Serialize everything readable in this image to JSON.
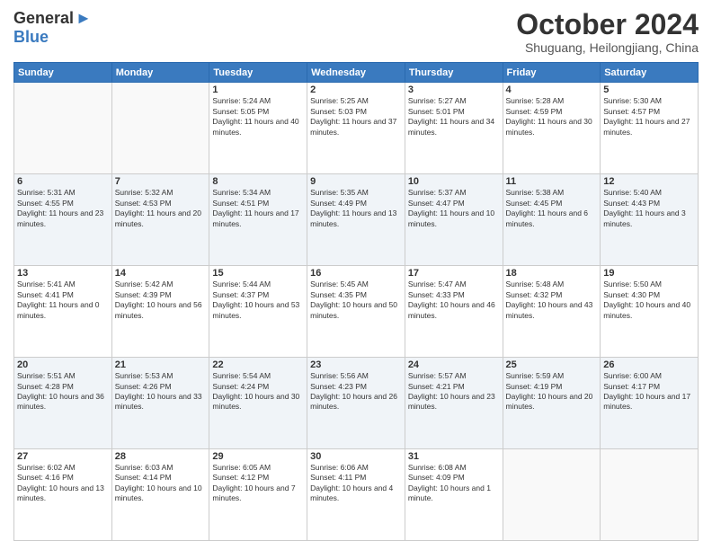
{
  "logo": {
    "general": "General",
    "blue": "Blue",
    "arrow": "▶"
  },
  "title": "October 2024",
  "location": "Shuguang, Heilongjiang, China",
  "days_of_week": [
    "Sunday",
    "Monday",
    "Tuesday",
    "Wednesday",
    "Thursday",
    "Friday",
    "Saturday"
  ],
  "weeks": [
    [
      {
        "day": "",
        "info": ""
      },
      {
        "day": "",
        "info": ""
      },
      {
        "day": "1",
        "info": "Sunrise: 5:24 AM\nSunset: 5:05 PM\nDaylight: 11 hours and 40 minutes."
      },
      {
        "day": "2",
        "info": "Sunrise: 5:25 AM\nSunset: 5:03 PM\nDaylight: 11 hours and 37 minutes."
      },
      {
        "day": "3",
        "info": "Sunrise: 5:27 AM\nSunset: 5:01 PM\nDaylight: 11 hours and 34 minutes."
      },
      {
        "day": "4",
        "info": "Sunrise: 5:28 AM\nSunset: 4:59 PM\nDaylight: 11 hours and 30 minutes."
      },
      {
        "day": "5",
        "info": "Sunrise: 5:30 AM\nSunset: 4:57 PM\nDaylight: 11 hours and 27 minutes."
      }
    ],
    [
      {
        "day": "6",
        "info": "Sunrise: 5:31 AM\nSunset: 4:55 PM\nDaylight: 11 hours and 23 minutes."
      },
      {
        "day": "7",
        "info": "Sunrise: 5:32 AM\nSunset: 4:53 PM\nDaylight: 11 hours and 20 minutes."
      },
      {
        "day": "8",
        "info": "Sunrise: 5:34 AM\nSunset: 4:51 PM\nDaylight: 11 hours and 17 minutes."
      },
      {
        "day": "9",
        "info": "Sunrise: 5:35 AM\nSunset: 4:49 PM\nDaylight: 11 hours and 13 minutes."
      },
      {
        "day": "10",
        "info": "Sunrise: 5:37 AM\nSunset: 4:47 PM\nDaylight: 11 hours and 10 minutes."
      },
      {
        "day": "11",
        "info": "Sunrise: 5:38 AM\nSunset: 4:45 PM\nDaylight: 11 hours and 6 minutes."
      },
      {
        "day": "12",
        "info": "Sunrise: 5:40 AM\nSunset: 4:43 PM\nDaylight: 11 hours and 3 minutes."
      }
    ],
    [
      {
        "day": "13",
        "info": "Sunrise: 5:41 AM\nSunset: 4:41 PM\nDaylight: 11 hours and 0 minutes."
      },
      {
        "day": "14",
        "info": "Sunrise: 5:42 AM\nSunset: 4:39 PM\nDaylight: 10 hours and 56 minutes."
      },
      {
        "day": "15",
        "info": "Sunrise: 5:44 AM\nSunset: 4:37 PM\nDaylight: 10 hours and 53 minutes."
      },
      {
        "day": "16",
        "info": "Sunrise: 5:45 AM\nSunset: 4:35 PM\nDaylight: 10 hours and 50 minutes."
      },
      {
        "day": "17",
        "info": "Sunrise: 5:47 AM\nSunset: 4:33 PM\nDaylight: 10 hours and 46 minutes."
      },
      {
        "day": "18",
        "info": "Sunrise: 5:48 AM\nSunset: 4:32 PM\nDaylight: 10 hours and 43 minutes."
      },
      {
        "day": "19",
        "info": "Sunrise: 5:50 AM\nSunset: 4:30 PM\nDaylight: 10 hours and 40 minutes."
      }
    ],
    [
      {
        "day": "20",
        "info": "Sunrise: 5:51 AM\nSunset: 4:28 PM\nDaylight: 10 hours and 36 minutes."
      },
      {
        "day": "21",
        "info": "Sunrise: 5:53 AM\nSunset: 4:26 PM\nDaylight: 10 hours and 33 minutes."
      },
      {
        "day": "22",
        "info": "Sunrise: 5:54 AM\nSunset: 4:24 PM\nDaylight: 10 hours and 30 minutes."
      },
      {
        "day": "23",
        "info": "Sunrise: 5:56 AM\nSunset: 4:23 PM\nDaylight: 10 hours and 26 minutes."
      },
      {
        "day": "24",
        "info": "Sunrise: 5:57 AM\nSunset: 4:21 PM\nDaylight: 10 hours and 23 minutes."
      },
      {
        "day": "25",
        "info": "Sunrise: 5:59 AM\nSunset: 4:19 PM\nDaylight: 10 hours and 20 minutes."
      },
      {
        "day": "26",
        "info": "Sunrise: 6:00 AM\nSunset: 4:17 PM\nDaylight: 10 hours and 17 minutes."
      }
    ],
    [
      {
        "day": "27",
        "info": "Sunrise: 6:02 AM\nSunset: 4:16 PM\nDaylight: 10 hours and 13 minutes."
      },
      {
        "day": "28",
        "info": "Sunrise: 6:03 AM\nSunset: 4:14 PM\nDaylight: 10 hours and 10 minutes."
      },
      {
        "day": "29",
        "info": "Sunrise: 6:05 AM\nSunset: 4:12 PM\nDaylight: 10 hours and 7 minutes."
      },
      {
        "day": "30",
        "info": "Sunrise: 6:06 AM\nSunset: 4:11 PM\nDaylight: 10 hours and 4 minutes."
      },
      {
        "day": "31",
        "info": "Sunrise: 6:08 AM\nSunset: 4:09 PM\nDaylight: 10 hours and 1 minute."
      },
      {
        "day": "",
        "info": ""
      },
      {
        "day": "",
        "info": ""
      }
    ]
  ]
}
